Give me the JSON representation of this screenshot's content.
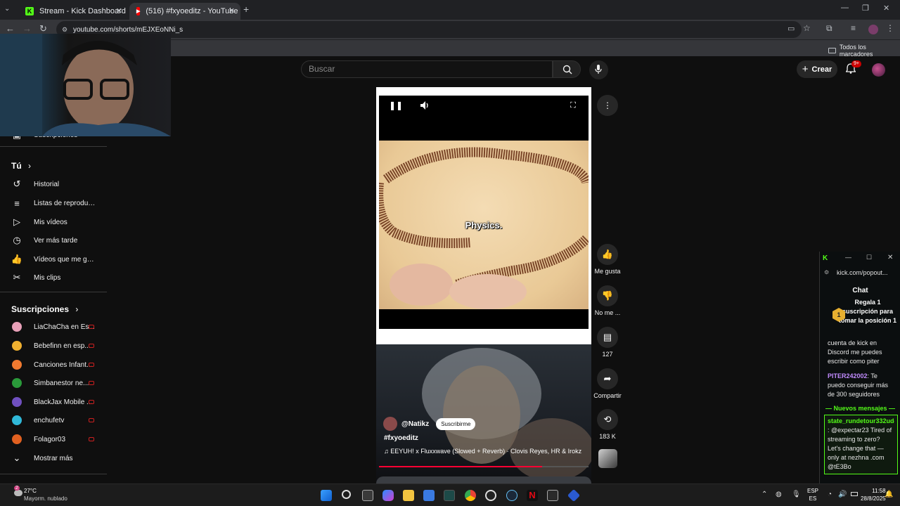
{
  "tabs": [
    {
      "title": "Stream - Kick Dashboard",
      "active": false
    },
    {
      "title": "(516) #fxyoeditz - YouTube",
      "active": true
    }
  ],
  "address": {
    "url": "youtube.com/shorts/mEJXEoNNi_s"
  },
  "bookmarks": {
    "all_label": "Todos los marcadores"
  },
  "youtube": {
    "search_placeholder": "Buscar",
    "create_label": "Crear",
    "notification_count": "9+",
    "sidebar": {
      "partial_item": "Suscripciones",
      "you_title": "Tú",
      "you_items": [
        "Historial",
        "Listas de reproducc...",
        "Mis vídeos",
        "Ver más tarde",
        "Vídeos que me gus...",
        "Mis clips"
      ],
      "subs_title": "Suscripciones",
      "subscriptions": [
        "LiaChaCha en Es...",
        "Bebefinn en esp...",
        "Canciones Infant...",
        "Simbanestor ne...",
        "BlackJax Mobile ...",
        "enchufetv",
        "Folagor03"
      ],
      "show_more": "Mostrar más"
    },
    "short": {
      "caption": "Physics.",
      "next_channel": "@Natikz",
      "subscribe_label": "Suscribirme",
      "next_hashtag": "#fxyoeditz",
      "next_music": "EEYUH! x Fluxxwave (Slowed + Reverb) · Clovis Reyes, HR & Irokz",
      "progress": 0.78
    },
    "actions": {
      "like": "Me gusta",
      "dislike": "No me ...",
      "comments": "127",
      "share": "Compartir",
      "remix": "183 K"
    }
  },
  "kick_popup": {
    "url": "kick.com/popout...",
    "chat_title": "Chat",
    "pinned": "Regala 1 suscripción para tomar la posición 1",
    "msg1": "cuenta de kick en Discord me puedes escribir como piter",
    "msg2_user": "PITER242002",
    "msg2_text": ": Te puedo conseguir más de 300 seguidores",
    "new_messages": "Nuevos mensajes",
    "msg3_user": "state_rundetour332ud4",
    "msg3_text": ": @expectar23 Tired of streaming to zero? Let's change that — only at nezhna .com @tE3Bo"
  },
  "taskbar": {
    "weather_temp": "27°C",
    "weather_desc": "Mayorm. nublado",
    "weather_badge": "2",
    "lang1": "ESP",
    "lang2": "ES",
    "time": "11:58",
    "date": "28/8/2025"
  },
  "colors": {
    "youtube_red": "#ff0000",
    "kick_green": "#53fc18",
    "progress_red": "#ff0033"
  }
}
